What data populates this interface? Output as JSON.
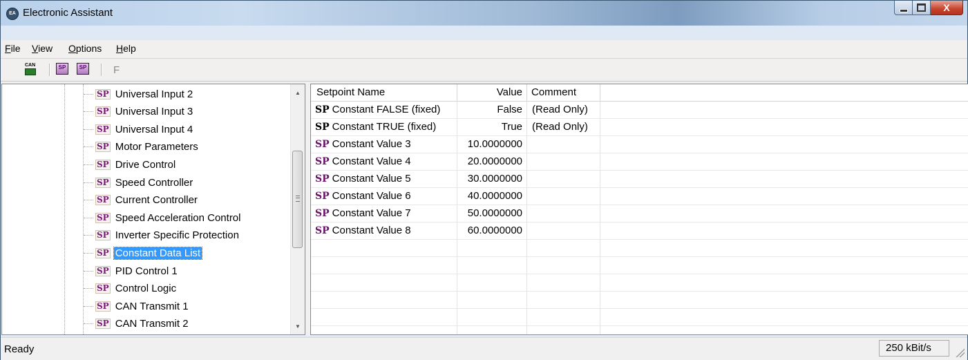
{
  "window": {
    "title": "Electronic Assistant",
    "close_glyph": "X"
  },
  "menu": [
    {
      "accel": "F",
      "rest": "ile"
    },
    {
      "accel": "V",
      "rest": "iew"
    },
    {
      "accel": "O",
      "rest": "ptions"
    },
    {
      "accel": "H",
      "rest": "elp"
    }
  ],
  "toolbar": {
    "can_label": "CAN",
    "sp_label": "SP",
    "f_label": "F"
  },
  "tree": {
    "badge": "SP",
    "items": [
      "Universal Input 2",
      "Universal Input 3",
      "Universal Input 4",
      "Motor Parameters",
      "Drive Control",
      "Speed Controller",
      "Current Controller",
      "Speed Acceleration Control",
      "Inverter Specific Protection",
      "Constant Data List",
      "PID Control 1",
      "Control Logic",
      "CAN Transmit 1",
      "CAN Transmit 2"
    ],
    "selected_index": 9
  },
  "table": {
    "headers": {
      "name": "Setpoint Name",
      "value": "Value",
      "comment": "Comment"
    },
    "prefix": "SP",
    "rows": [
      {
        "name": "Constant FALSE (fixed)",
        "value": "False",
        "comment": "(Read Only)",
        "fixed": true
      },
      {
        "name": "Constant TRUE (fixed)",
        "value": "True",
        "comment": "(Read Only)",
        "fixed": true
      },
      {
        "name": "Constant Value 3",
        "value": "10.0000000",
        "comment": "",
        "fixed": false
      },
      {
        "name": "Constant Value 4",
        "value": "20.0000000",
        "comment": "",
        "fixed": false
      },
      {
        "name": "Constant Value 5",
        "value": "30.0000000",
        "comment": "",
        "fixed": false
      },
      {
        "name": "Constant Value 6",
        "value": "40.0000000",
        "comment": "",
        "fixed": false
      },
      {
        "name": "Constant Value 7",
        "value": "50.0000000",
        "comment": "",
        "fixed": false
      },
      {
        "name": "Constant Value 8",
        "value": "60.0000000",
        "comment": "",
        "fixed": false
      },
      {
        "name": "",
        "value": "",
        "comment": "",
        "fixed": false
      },
      {
        "name": "",
        "value": "",
        "comment": "",
        "fixed": false
      },
      {
        "name": "",
        "value": "",
        "comment": "",
        "fixed": false
      },
      {
        "name": "",
        "value": "",
        "comment": "",
        "fixed": false
      },
      {
        "name": "",
        "value": "",
        "comment": "",
        "fixed": false
      },
      {
        "name": "",
        "value": "",
        "comment": "",
        "fixed": false
      }
    ]
  },
  "status": {
    "text": "Ready",
    "baud": "250 kBit/s"
  }
}
